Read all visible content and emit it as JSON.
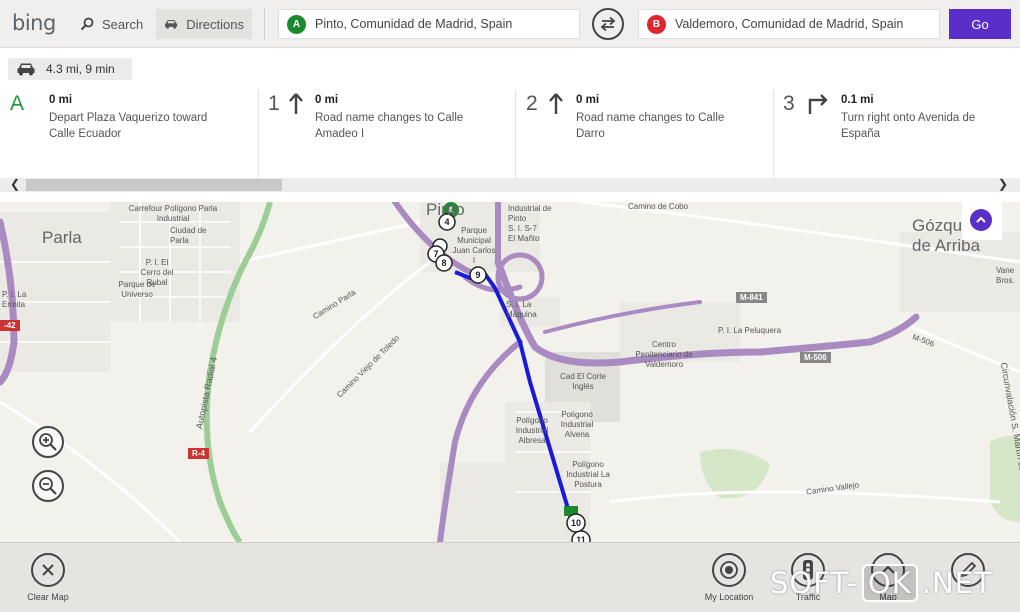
{
  "header": {
    "logo": "bing",
    "search_label": "Search",
    "directions_label": "Directions",
    "from": {
      "pin": "A",
      "value": "Pinto, Comunidad de Madrid, Spain"
    },
    "to": {
      "pin": "B",
      "value": "Valdemoro, Comunidad de Madrid, Spain"
    },
    "go_label": "Go"
  },
  "route": {
    "summary": "4.3 mi, 9 min",
    "steps": [
      {
        "num": "A",
        "icon": "start-marker",
        "distance": "0 mi",
        "instruction": "Depart Plaza Vaquerizo toward Calle Ecuador"
      },
      {
        "num": "1",
        "icon": "arrow-up-icon",
        "distance": "0 mi",
        "instruction": "Road name changes to Calle Amadeo I"
      },
      {
        "num": "2",
        "icon": "arrow-up-icon",
        "distance": "0 mi",
        "instruction": "Road name changes to Calle Darro"
      },
      {
        "num": "3",
        "icon": "turn-right-icon",
        "distance": "0.1 mi",
        "instruction": "Turn right onto Avenida de España"
      }
    ]
  },
  "map": {
    "labels": {
      "parla": "Parla",
      "gozquez": "Gózquez de Arriba",
      "pinto": "Pinto",
      "carrefour": "Carrefour Polígono Parla Industrial",
      "ciudad_parla": "Ciudad de Parla",
      "cerro": "P. I. El Cerro del Rubal",
      "parque_univ": "Parque de Universo",
      "ermita": "P. I. La Ermita",
      "camino_parla": "Camino Parla",
      "camino_toledo": "Camino Viejo de Toledo",
      "autopista": "Autopista Radial 4",
      "parque_municipal": "Parque Municipal Juan Carlos I",
      "industrial_pinto": "Industrial de Pinto",
      "s57": "S. I. S-7 El Mañto",
      "maquina": "S. I. La Máquina",
      "peluquera": "P. I. La Peluquera",
      "centro_pen": "Centro Penitenciario de Valdemoro",
      "cad": "Cad El Corte Inglés",
      "alvena": "Polígono Industrial Alvena",
      "albresa": "Polígono Industrial Albresa",
      "postura": "Polígono Industrial La Postura",
      "camino_cobo": "Camino de Cobo",
      "camino_valli": "Camino Vallejo",
      "circunvalacion": "Circunvalación S. Martín de",
      "vane": "Vane Bros.",
      "m841": "M-841",
      "m506": "M-506",
      "m506b": "M-506",
      "r4": "R-4",
      "sign42": "-42"
    },
    "waypoints": [
      "A",
      "4",
      "7",
      "8",
      "9",
      "10",
      "11"
    ],
    "route_color": "#1a1adb"
  },
  "bottom": {
    "clear_map": "Clear Map",
    "my_location": "My Location",
    "traffic": "Traffic",
    "map_style": "Map",
    "edit": ""
  },
  "watermark": {
    "left": "SOFT-",
    "box": "OK",
    "right": ".NET"
  }
}
